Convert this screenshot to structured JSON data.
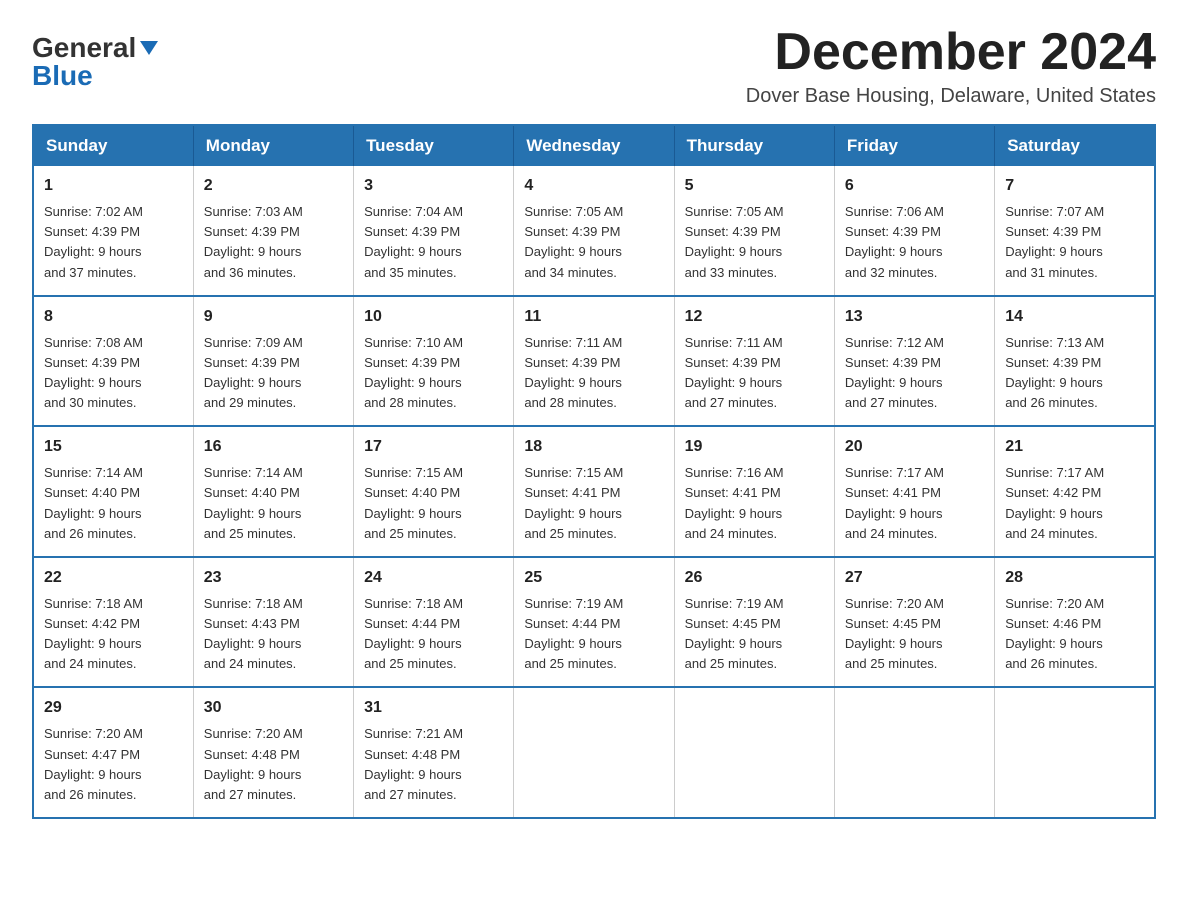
{
  "header": {
    "logo_general": "General",
    "logo_blue": "Blue",
    "month_title": "December 2024",
    "location": "Dover Base Housing, Delaware, United States"
  },
  "weekdays": [
    "Sunday",
    "Monday",
    "Tuesday",
    "Wednesday",
    "Thursday",
    "Friday",
    "Saturday"
  ],
  "weeks": [
    [
      {
        "day": "1",
        "sunrise": "7:02 AM",
        "sunset": "4:39 PM",
        "daylight": "9 hours and 37 minutes."
      },
      {
        "day": "2",
        "sunrise": "7:03 AM",
        "sunset": "4:39 PM",
        "daylight": "9 hours and 36 minutes."
      },
      {
        "day": "3",
        "sunrise": "7:04 AM",
        "sunset": "4:39 PM",
        "daylight": "9 hours and 35 minutes."
      },
      {
        "day": "4",
        "sunrise": "7:05 AM",
        "sunset": "4:39 PM",
        "daylight": "9 hours and 34 minutes."
      },
      {
        "day": "5",
        "sunrise": "7:05 AM",
        "sunset": "4:39 PM",
        "daylight": "9 hours and 33 minutes."
      },
      {
        "day": "6",
        "sunrise": "7:06 AM",
        "sunset": "4:39 PM",
        "daylight": "9 hours and 32 minutes."
      },
      {
        "day": "7",
        "sunrise": "7:07 AM",
        "sunset": "4:39 PM",
        "daylight": "9 hours and 31 minutes."
      }
    ],
    [
      {
        "day": "8",
        "sunrise": "7:08 AM",
        "sunset": "4:39 PM",
        "daylight": "9 hours and 30 minutes."
      },
      {
        "day": "9",
        "sunrise": "7:09 AM",
        "sunset": "4:39 PM",
        "daylight": "9 hours and 29 minutes."
      },
      {
        "day": "10",
        "sunrise": "7:10 AM",
        "sunset": "4:39 PM",
        "daylight": "9 hours and 28 minutes."
      },
      {
        "day": "11",
        "sunrise": "7:11 AM",
        "sunset": "4:39 PM",
        "daylight": "9 hours and 28 minutes."
      },
      {
        "day": "12",
        "sunrise": "7:11 AM",
        "sunset": "4:39 PM",
        "daylight": "9 hours and 27 minutes."
      },
      {
        "day": "13",
        "sunrise": "7:12 AM",
        "sunset": "4:39 PM",
        "daylight": "9 hours and 27 minutes."
      },
      {
        "day": "14",
        "sunrise": "7:13 AM",
        "sunset": "4:39 PM",
        "daylight": "9 hours and 26 minutes."
      }
    ],
    [
      {
        "day": "15",
        "sunrise": "7:14 AM",
        "sunset": "4:40 PM",
        "daylight": "9 hours and 26 minutes."
      },
      {
        "day": "16",
        "sunrise": "7:14 AM",
        "sunset": "4:40 PM",
        "daylight": "9 hours and 25 minutes."
      },
      {
        "day": "17",
        "sunrise": "7:15 AM",
        "sunset": "4:40 PM",
        "daylight": "9 hours and 25 minutes."
      },
      {
        "day": "18",
        "sunrise": "7:15 AM",
        "sunset": "4:41 PM",
        "daylight": "9 hours and 25 minutes."
      },
      {
        "day": "19",
        "sunrise": "7:16 AM",
        "sunset": "4:41 PM",
        "daylight": "9 hours and 24 minutes."
      },
      {
        "day": "20",
        "sunrise": "7:17 AM",
        "sunset": "4:41 PM",
        "daylight": "9 hours and 24 minutes."
      },
      {
        "day": "21",
        "sunrise": "7:17 AM",
        "sunset": "4:42 PM",
        "daylight": "9 hours and 24 minutes."
      }
    ],
    [
      {
        "day": "22",
        "sunrise": "7:18 AM",
        "sunset": "4:42 PM",
        "daylight": "9 hours and 24 minutes."
      },
      {
        "day": "23",
        "sunrise": "7:18 AM",
        "sunset": "4:43 PM",
        "daylight": "9 hours and 24 minutes."
      },
      {
        "day": "24",
        "sunrise": "7:18 AM",
        "sunset": "4:44 PM",
        "daylight": "9 hours and 25 minutes."
      },
      {
        "day": "25",
        "sunrise": "7:19 AM",
        "sunset": "4:44 PM",
        "daylight": "9 hours and 25 minutes."
      },
      {
        "day": "26",
        "sunrise": "7:19 AM",
        "sunset": "4:45 PM",
        "daylight": "9 hours and 25 minutes."
      },
      {
        "day": "27",
        "sunrise": "7:20 AM",
        "sunset": "4:45 PM",
        "daylight": "9 hours and 25 minutes."
      },
      {
        "day": "28",
        "sunrise": "7:20 AM",
        "sunset": "4:46 PM",
        "daylight": "9 hours and 26 minutes."
      }
    ],
    [
      {
        "day": "29",
        "sunrise": "7:20 AM",
        "sunset": "4:47 PM",
        "daylight": "9 hours and 26 minutes."
      },
      {
        "day": "30",
        "sunrise": "7:20 AM",
        "sunset": "4:48 PM",
        "daylight": "9 hours and 27 minutes."
      },
      {
        "day": "31",
        "sunrise": "7:21 AM",
        "sunset": "4:48 PM",
        "daylight": "9 hours and 27 minutes."
      },
      null,
      null,
      null,
      null
    ]
  ],
  "labels": {
    "sunrise": "Sunrise:",
    "sunset": "Sunset:",
    "daylight": "Daylight:"
  }
}
